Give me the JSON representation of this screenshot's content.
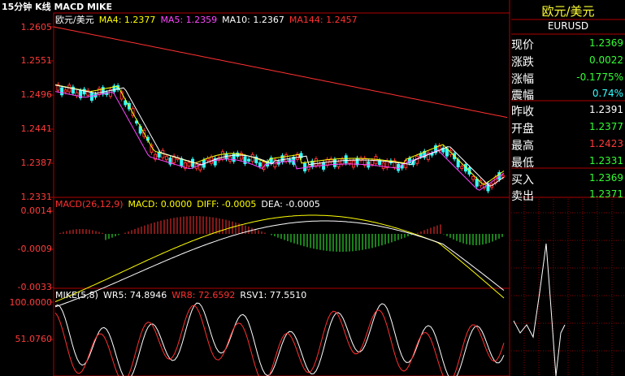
{
  "header": {
    "title": "15分钟 K线 MACD MIKE"
  },
  "kline": {
    "legend": [
      {
        "label": "欧元/美元",
        "color": "#ffffff"
      },
      {
        "label": "MA4: 1.2377",
        "color": "#ffff00"
      },
      {
        "label": "MA5: 1.2359",
        "color": "#ff44ff"
      },
      {
        "label": "MA10: 1.2367",
        "color": "#ffffff"
      },
      {
        "label": "MA144: 1.2457",
        "color": "#ff3030"
      }
    ],
    "y_labels": [
      "1.2605",
      "1.2551",
      "1.2496",
      "1.2441",
      "1.2387",
      "1.2331"
    ]
  },
  "macd": {
    "legend": [
      {
        "label": "MACD(26,12,9)",
        "color": "#ff3030"
      },
      {
        "label": "MACD: 0.0000",
        "color": "#ffff00"
      },
      {
        "label": "DIFF: -0.0005",
        "color": "#ffff00"
      },
      {
        "label": "DEA: -0.0005",
        "color": "#ffffff"
      }
    ],
    "y_labels": [
      "0.0014",
      "-0.0009",
      "-0.0033"
    ]
  },
  "mike": {
    "legend": [
      {
        "label": "MIKE(5,8)",
        "color": "#ffffff"
      },
      {
        "label": "WR5: 74.8946",
        "color": "#ffffff"
      },
      {
        "label": "WR8: 72.6592",
        "color": "#ff3030"
      },
      {
        "label": "RSV1: 77.5510",
        "color": "#ffffff"
      }
    ],
    "y_labels": [
      "100.0000",
      "51.0760"
    ]
  },
  "quote": {
    "name": "欧元/美元",
    "code": "EURUSD",
    "rows": [
      {
        "label": "现价",
        "value": "1.2369",
        "color": "#33ff33"
      },
      {
        "label": "涨跌",
        "value": "0.0022",
        "color": "#33ff33"
      },
      {
        "label": "涨幅",
        "value": "-0.1775%",
        "color": "#33ff33"
      },
      {
        "label": "震幅",
        "value": "0.74%",
        "color": "#33ffff"
      },
      {
        "label": "昨收",
        "value": "1.2391",
        "color": "#ffffff"
      },
      {
        "label": "开盘",
        "value": "1.2377",
        "color": "#33ff33"
      },
      {
        "label": "最高",
        "value": "1.2423",
        "color": "#ff3b3b"
      },
      {
        "label": "最低",
        "value": "1.2331",
        "color": "#33ff33"
      },
      {
        "label": "买入",
        "value": "1.2369",
        "color": "#33ff33"
      },
      {
        "label": "卖出",
        "value": "1.2371",
        "color": "#33ff33"
      }
    ]
  }
}
